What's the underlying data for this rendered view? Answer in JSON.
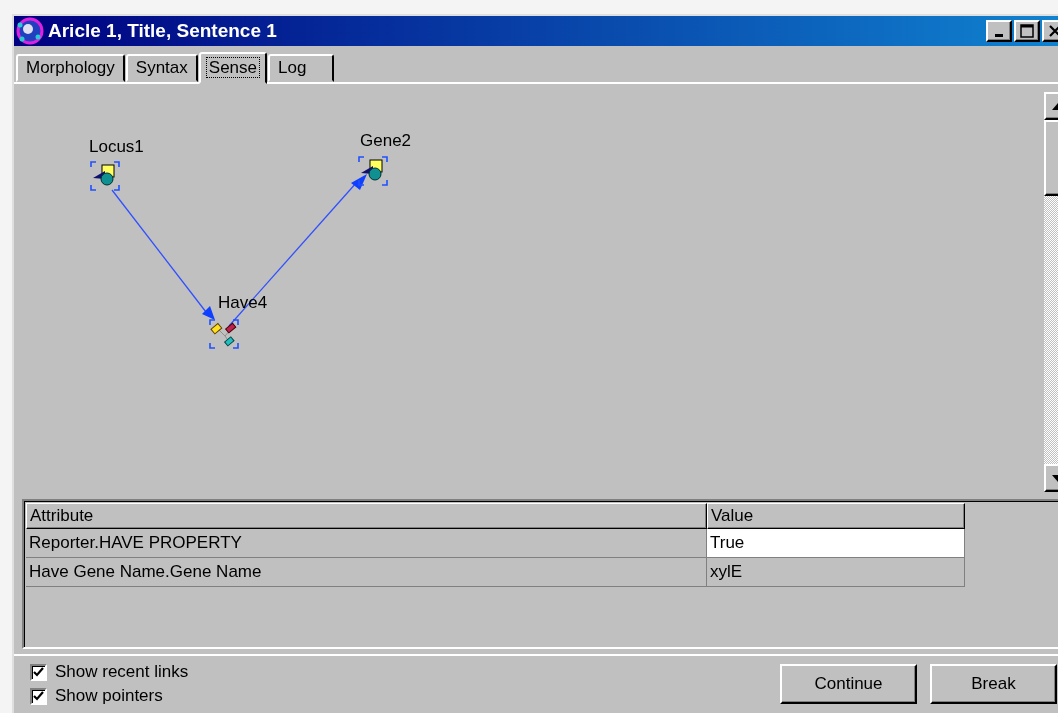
{
  "window": {
    "title": "Aricle 1, Title, Sentence 1"
  },
  "tabs": [
    {
      "label": "Morphology",
      "selected": false
    },
    {
      "label": "Syntax",
      "selected": false
    },
    {
      "label": "Sense",
      "selected": true
    },
    {
      "label": "Log",
      "selected": false
    }
  ],
  "diagram": {
    "nodes": [
      {
        "label": "Locus1",
        "kind": "entity"
      },
      {
        "label": "Gene2",
        "kind": "entity"
      },
      {
        "label": "Have4",
        "kind": "relation"
      }
    ]
  },
  "table": {
    "columns": [
      "Attribute",
      "Value"
    ],
    "rows": [
      {
        "cells": [
          "Reporter.HAVE PROPERTY",
          "True"
        ],
        "selected": true
      },
      {
        "cells": [
          "Have Gene Name.Gene Name",
          "xylE"
        ],
        "selected": false
      }
    ]
  },
  "options": [
    {
      "label": "Show recent links",
      "checked": true
    },
    {
      "label": "Show pointers",
      "checked": true
    }
  ],
  "buttons": [
    "Continue",
    "Break"
  ]
}
